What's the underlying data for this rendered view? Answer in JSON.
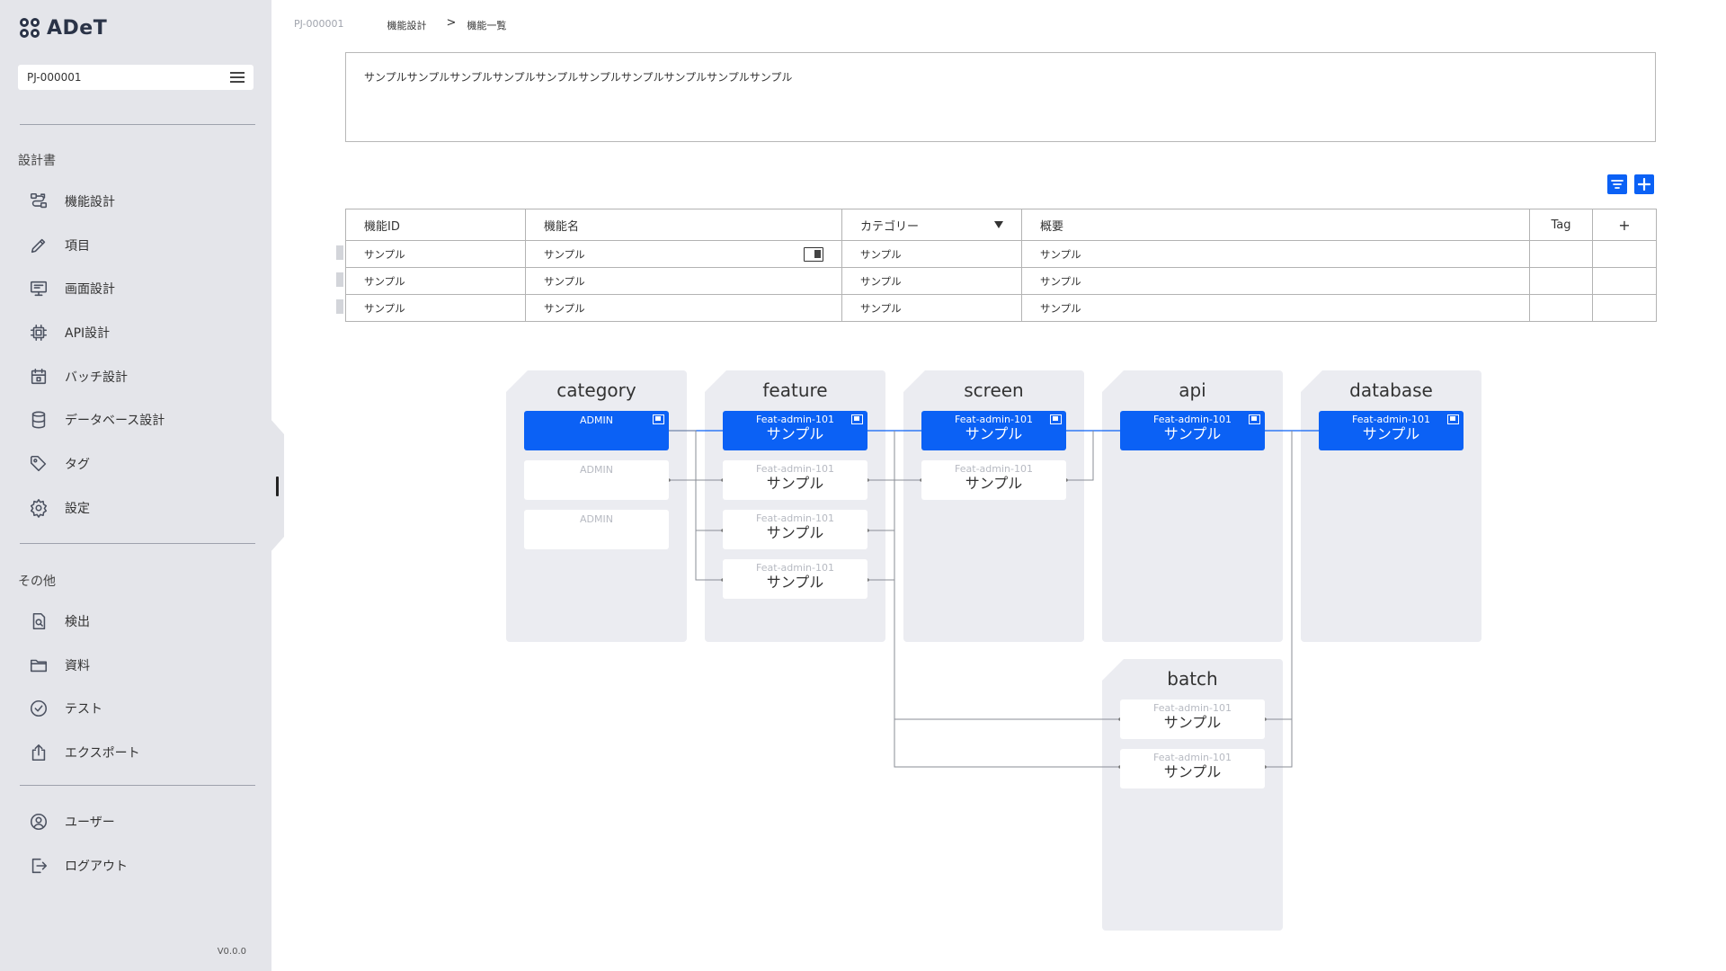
{
  "app": {
    "logo_text": "ADeT",
    "version": "V0.0.0"
  },
  "sidebar": {
    "project": "PJ-000001",
    "section_design": "設計書",
    "design_items": [
      {
        "label": "機能設計",
        "icon": "flow-icon"
      },
      {
        "label": "項目",
        "icon": "pencil-icon"
      },
      {
        "label": "画面設計",
        "icon": "monitor-icon"
      },
      {
        "label": "API設計",
        "icon": "chip-icon"
      },
      {
        "label": "バッチ設計",
        "icon": "calendar-icon"
      },
      {
        "label": "データベース設計",
        "icon": "database-icon"
      },
      {
        "label": "タグ",
        "icon": "tag-icon"
      },
      {
        "label": "設定",
        "icon": "gear-icon"
      }
    ],
    "section_other": "その他",
    "other_items": [
      {
        "label": "検出",
        "icon": "document-search-icon"
      },
      {
        "label": "資料",
        "icon": "folder-icon"
      },
      {
        "label": "テスト",
        "icon": "check-circle-icon"
      },
      {
        "label": "エクスポート",
        "icon": "export-icon"
      }
    ],
    "account_items": [
      {
        "label": "ユーザー",
        "icon": "user-icon"
      },
      {
        "label": "ログアウト",
        "icon": "logout-icon"
      }
    ]
  },
  "breadcrumb": {
    "project": "PJ-000001",
    "parent": "機能設計",
    "sep": ">",
    "current": "機能一覧"
  },
  "description": "サンプルサンプルサンプルサンプルサンプルサンプルサンプルサンプルサンプルサンプル",
  "toolbar": {
    "filter_icon": "filter-icon",
    "add_icon": "plus-icon"
  },
  "table": {
    "headers": {
      "id": "機能ID",
      "name": "機能名",
      "category": "カテゴリー",
      "summary": "概要",
      "tag": "Tag",
      "add": "+"
    },
    "rows": [
      {
        "id": "サンプル",
        "name": "サンプル",
        "category": "サンプル",
        "summary": "サンプル",
        "tag": ""
      },
      {
        "id": "サンプル",
        "name": "サンプル",
        "category": "サンプル",
        "summary": "サンプル",
        "tag": ""
      },
      {
        "id": "サンプル",
        "name": "サンプル",
        "category": "サンプル",
        "summary": "サンプル",
        "tag": ""
      }
    ]
  },
  "diagram": {
    "lanes": {
      "category": "category",
      "feature": "feature",
      "screen": "screen",
      "api": "api",
      "database": "database",
      "batch": "batch"
    },
    "category_cards": [
      "ADMIN",
      "ADMIN",
      "ADMIN"
    ],
    "card_id": "Feat-admin-101",
    "card_name": "サンプル",
    "colors": {
      "accent": "#0b61f5",
      "lane": "#ebecf1",
      "link": "#8a8d96"
    }
  }
}
